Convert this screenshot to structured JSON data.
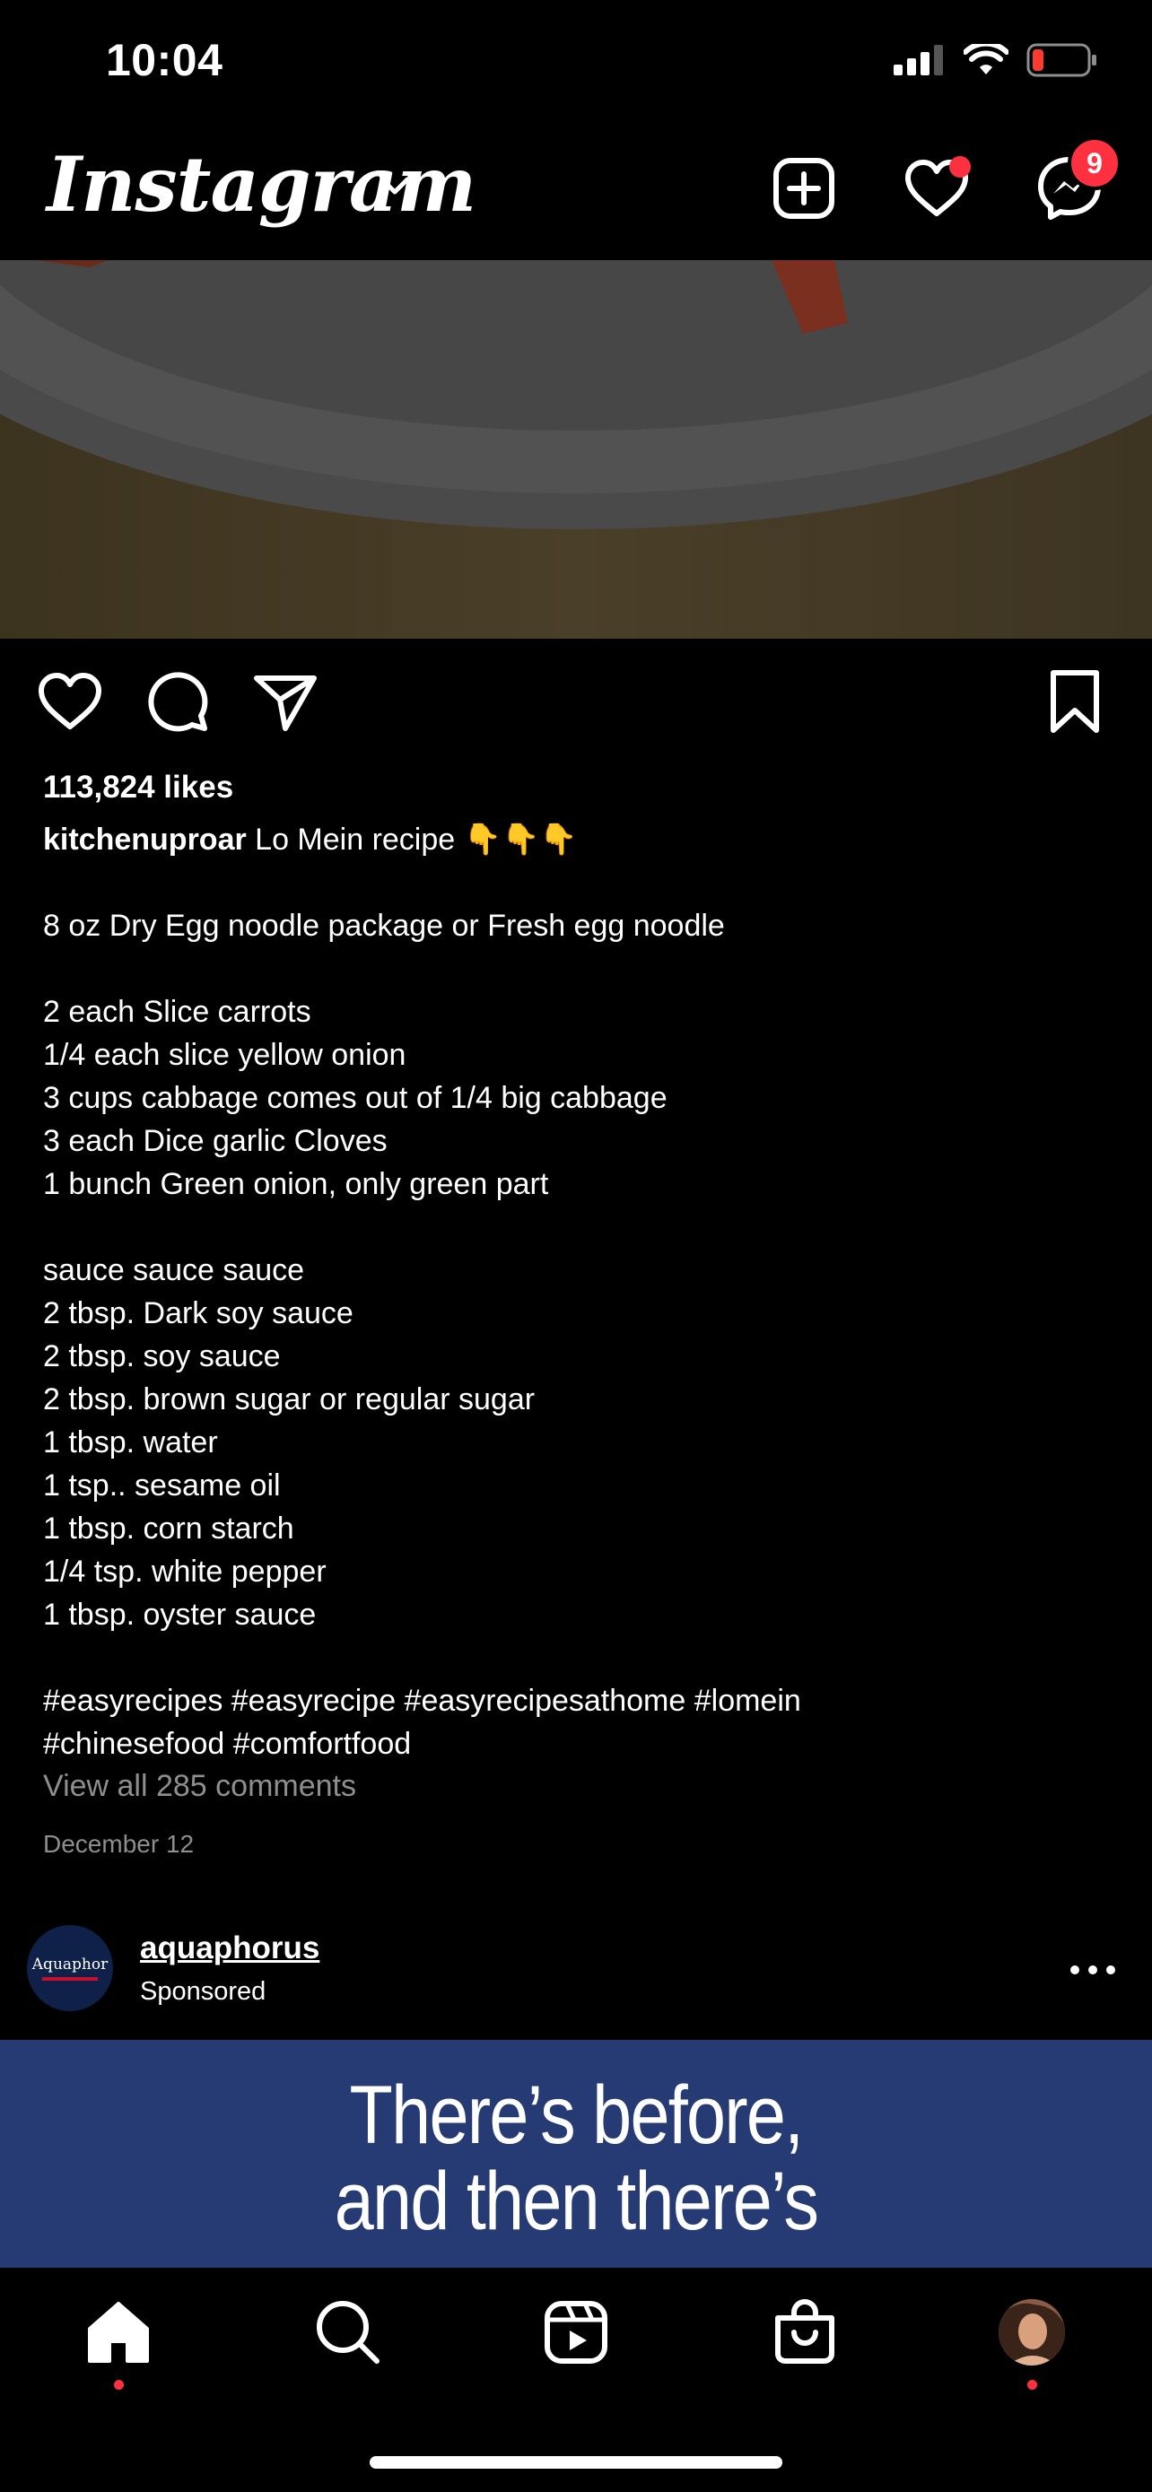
{
  "status_bar": {
    "time": "10:04",
    "battery_color": "#ff3b30"
  },
  "header": {
    "app_name": "Instagram",
    "notification_color": "#ff3040",
    "messages_badge": "9"
  },
  "post": {
    "likes": "113,824 likes",
    "username": "kitchenuproar",
    "caption": " Lo Mein recipe 👇👇👇\n\n8 oz Dry Egg noodle package or Fresh egg noodle\n\n2 each Slice carrots\n1/4 each slice yellow onion\n3 cups cabbage comes out of 1/4 big cabbage\n3 each Dice garlic Cloves\n1 bunch Green onion, only green part\n\nsauce sauce sauce\n2 tbsp. Dark soy sauce\n2 tbsp. soy sauce\n2 tbsp. brown sugar or regular sugar\n1 tbsp. water\n1 tsp.. sesame oil\n1 tbsp. corn starch\n1/4 tsp. white pepper\n1 tbsp. oyster sauce\n\n#easyrecipes #easyrecipe #easyrecipesathome #lomein\n#chinesefood #comfortfood",
    "view_comments": "View all 285 comments",
    "date": "December 12"
  },
  "sponsored_post": {
    "avatar_brand": "Aquaphor",
    "username": "aquaphorus",
    "label": "Sponsored",
    "banner_line1": "There’s before,",
    "banner_line2": "and then there’s",
    "banner_color": "#263a73"
  },
  "tab_bar": {
    "items": [
      "home-icon",
      "search-icon",
      "reels-icon",
      "shop-icon",
      "profile-avatar"
    ]
  }
}
